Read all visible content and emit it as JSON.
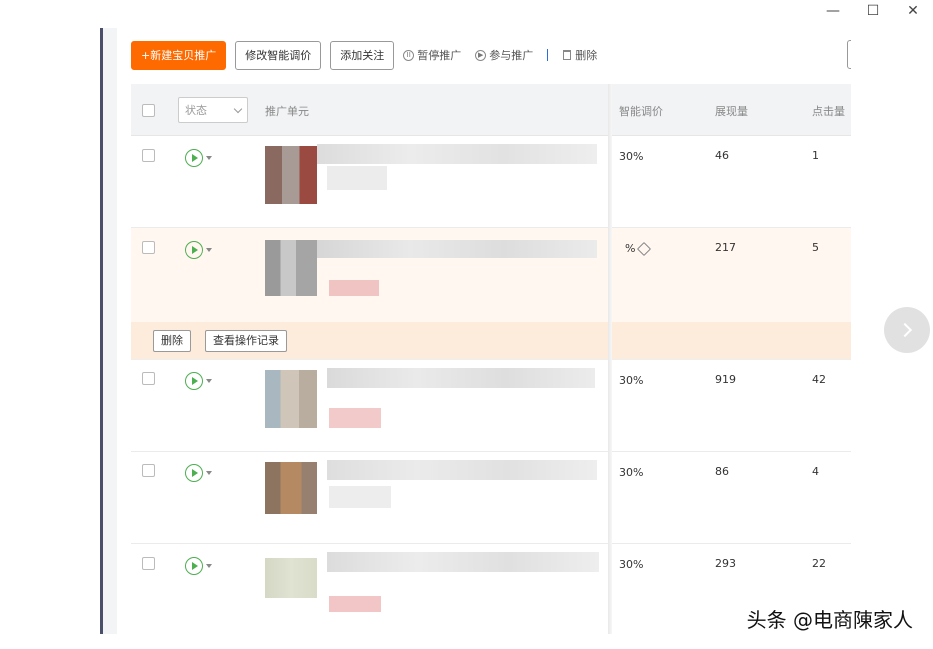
{
  "window": {
    "minimize": "—",
    "maximize": "☐",
    "close": "✕"
  },
  "toolbar": {
    "new_promo": "+新建宝贝推广",
    "modify_smart_price": "修改智能调价",
    "add_follow": "添加关注",
    "pause_promo": "暂停推广",
    "join_promo": "参与推广",
    "delete": "删除"
  },
  "header": {
    "status_placeholder": "状态",
    "promo_unit": "推广单元",
    "smart_price": "智能调价",
    "impressions": "展现量",
    "clicks": "点击量"
  },
  "rows": [
    {
      "smart_price": "30%",
      "impressions": "46",
      "clicks": "1"
    },
    {
      "smart_price": "%",
      "impressions": "217",
      "clicks": "5"
    },
    {
      "smart_price": "30%",
      "impressions": "919",
      "clicks": "42"
    },
    {
      "smart_price": "30%",
      "impressions": "86",
      "clicks": "4"
    },
    {
      "smart_price": "30%",
      "impressions": "293",
      "clicks": "22"
    }
  ],
  "row_actions": {
    "delete": "删除",
    "view_log": "查看操作记录"
  },
  "watermark": "头条 @电商陳家人",
  "colors": {
    "primary": "#ff6a00",
    "play_green": "#4caf50",
    "highlight": "#fff7f0",
    "action_bar": "#fdebdc"
  }
}
